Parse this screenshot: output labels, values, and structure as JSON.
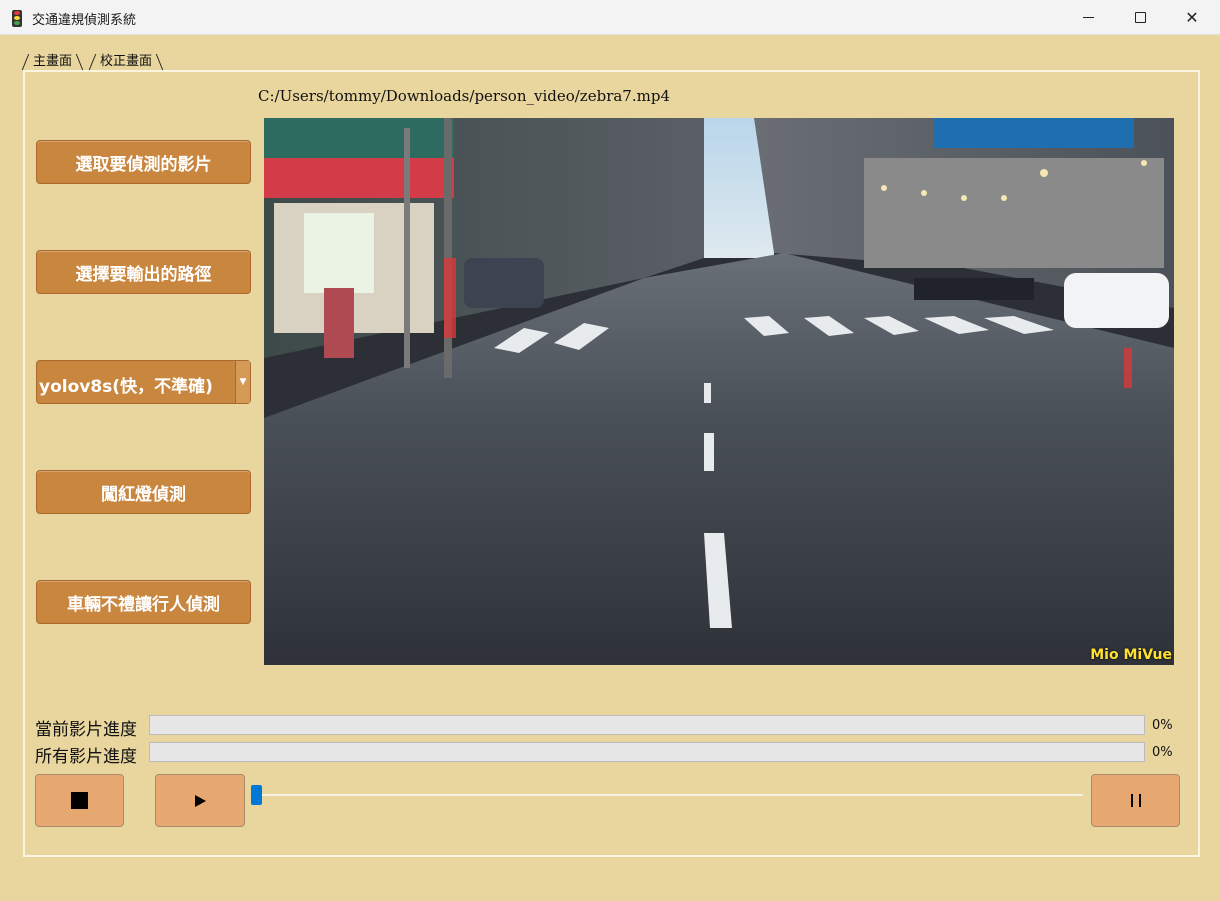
{
  "window": {
    "title": "交通違規偵測系統",
    "icon": "traffic-light-icon",
    "controls": [
      "minimize-icon",
      "maximize-icon",
      "close-icon"
    ]
  },
  "tabs": [
    {
      "label": "主畫面",
      "active": true
    },
    {
      "label": "校正畫面",
      "active": false
    }
  ],
  "file_path": "C:/Users/tommy/Downloads/person_video/zebra7.mp4",
  "sidebar": {
    "select_video_label": "選取要偵測的影片",
    "select_output_label": "選擇要輸出的路徑",
    "model_select": {
      "selected": "yolov8s(快，不準確)"
    },
    "red_light_label": "闖紅燈偵測",
    "pedestrian_label": "車輛不禮讓行人偵測"
  },
  "video": {
    "watermark": "Mio MiVue"
  },
  "progress": {
    "current_label": "當前影片進度",
    "current_percent": "0%",
    "current_value": 0,
    "all_label": "所有影片進度",
    "all_percent": "0%",
    "all_value": 0
  },
  "controls": {
    "stop_icon": "stop-icon",
    "play_icon": "play-icon",
    "pause_icon": "pause-icon",
    "seek_position": 0
  },
  "colors": {
    "background": "#e8d69e",
    "button": "#c9863f",
    "control_button": "#e6a870",
    "slider_thumb": "#0078d7"
  }
}
